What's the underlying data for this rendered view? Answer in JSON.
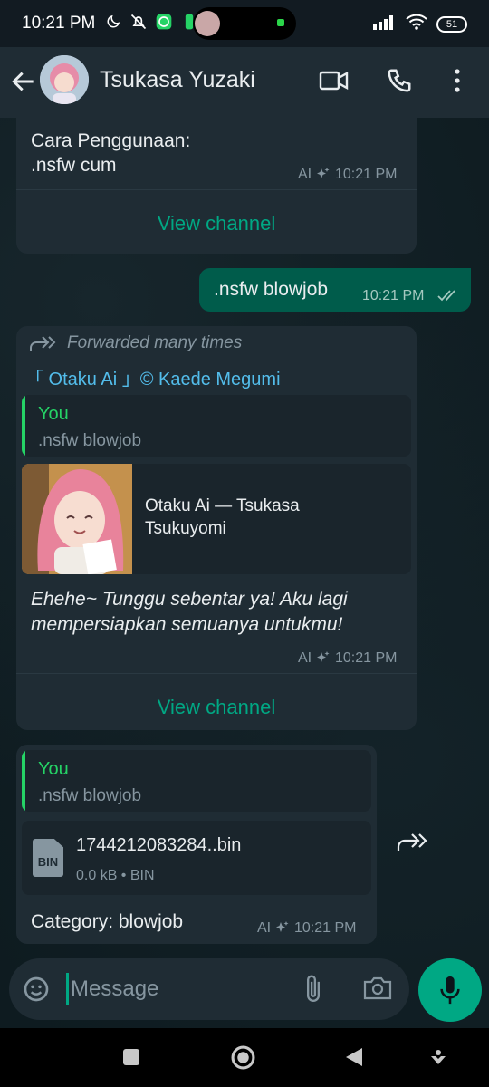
{
  "status_bar": {
    "time": "10:21 PM",
    "battery": "51",
    "icons_left": [
      "moon-icon",
      "bell-off-icon",
      "whatsapp-icon",
      "notification-icon"
    ],
    "icons_right": [
      "signal-icon",
      "wifi-icon",
      "battery-icon"
    ]
  },
  "header": {
    "contact_name": "Tsukasa Yuzaki",
    "icons": [
      "back-arrow-icon",
      "video-call-icon",
      "voice-call-icon",
      "more-vert-icon"
    ]
  },
  "messages": [
    {
      "id": "msg1",
      "direction": "incoming",
      "text_line1": "Cara Penggunaan:",
      "text_line2": ".nsfw cum",
      "ai_label": "AI",
      "time": "10:21 PM",
      "action": "View channel"
    },
    {
      "id": "msg2",
      "direction": "outgoing",
      "text": ".nsfw blowjob",
      "time": "10:21 PM"
    },
    {
      "id": "msg3",
      "direction": "incoming",
      "forwarded": "Forwarded many times",
      "channel": "「 Otaku Ai 」© Kaede Megumi",
      "quote_author": "You",
      "quote_text": ".nsfw blowjob",
      "link_title_line1": "Otaku Ai — Tsukasa",
      "link_title_line2": "Tsukuyomi",
      "body_line1": "Ehehe~ Tunggu sebentar ya! Aku lagi",
      "body_line2": "mempersiapkan semuanya untukmu!",
      "ai_label": "AI",
      "time": "10:21 PM",
      "action": "View channel"
    },
    {
      "id": "msg4",
      "direction": "incoming",
      "quote_author": "You",
      "quote_text": ".nsfw blowjob",
      "file_badge": "BIN",
      "file_name": "1744212083284..bin",
      "file_meta": "0.0 kB • BIN",
      "caption": "Category: blowjob",
      "ai_label": "AI",
      "time": "10:21 PM"
    }
  ],
  "input": {
    "placeholder": "Message"
  },
  "nav_icons": [
    "recent-apps-icon",
    "home-icon",
    "back-icon",
    "assistant-icon"
  ],
  "colors": {
    "accent": "#00a884",
    "incoming_bubble": "#1f2c34",
    "outgoing_bubble": "#005c4b",
    "link": "#53bdeb",
    "quote_green": "#25d366"
  }
}
